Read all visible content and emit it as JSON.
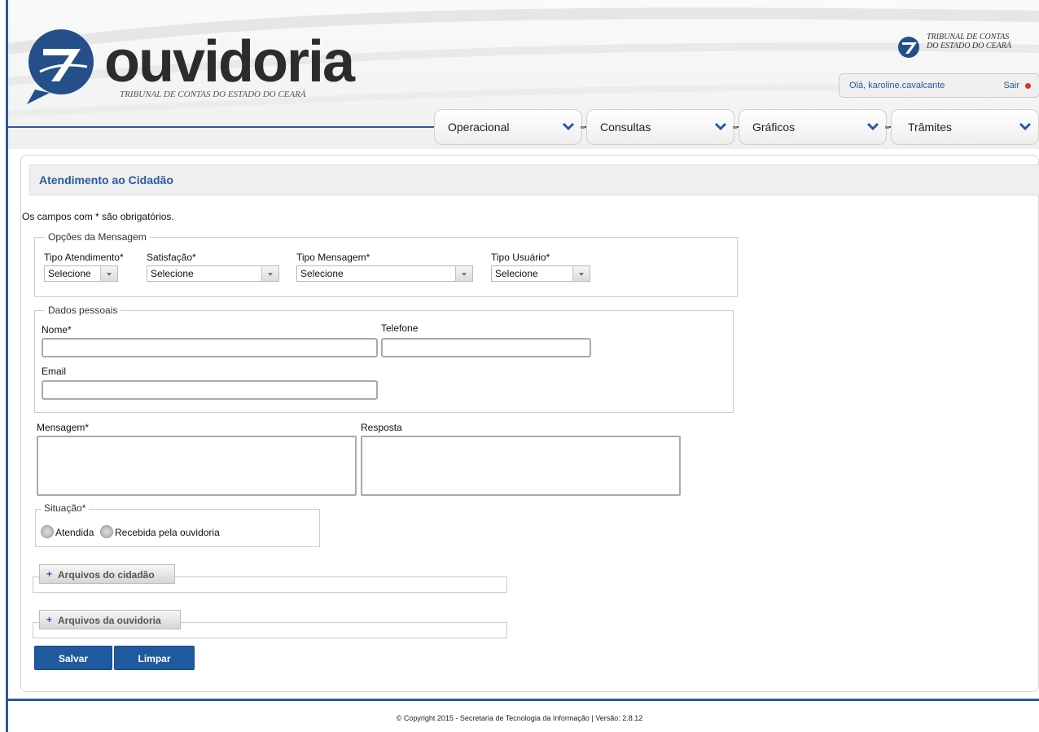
{
  "brand": {
    "name": "ouvidoria",
    "subtitle": "TRIBUNAL DE CONTAS DO ESTADO DO CEARÁ"
  },
  "org_logo": {
    "line1": "TRIBUNAL DE CONTAS",
    "line2": "DO ESTADO DO CEARÁ"
  },
  "user": {
    "greeting": "Olá, karoline.cavalcante",
    "logout": "Sair"
  },
  "menu": [
    {
      "label": "Operacional"
    },
    {
      "label": "Consultas"
    },
    {
      "label": "Gráficos"
    },
    {
      "label": "Trâmites"
    }
  ],
  "page": {
    "title": "Atendimento ao Cidadão",
    "required_note": "Os campos com * são obrigatórios."
  },
  "options": {
    "legend": "Opções da Mensagem",
    "tipo_atendimento": {
      "label": "Tipo Atendimento*",
      "value": "Selecione"
    },
    "satisfacao": {
      "label": "Satisfação*",
      "value": "Selecione"
    },
    "tipo_mensagem": {
      "label": "Tipo Mensagem*",
      "value": "Selecione"
    },
    "tipo_usuario": {
      "label": "Tipo Usuário*",
      "value": "Selecione"
    }
  },
  "personal": {
    "legend": "Dados pessoais",
    "nome": {
      "label": "Nome*",
      "value": ""
    },
    "telefone": {
      "label": "Telefone",
      "value": ""
    },
    "email": {
      "label": "Email",
      "value": ""
    }
  },
  "mensagem": {
    "label": "Mensagem*",
    "value": ""
  },
  "resposta": {
    "label": "Resposta",
    "value": ""
  },
  "situacao": {
    "legend": "Situação*",
    "options": [
      "Atendida",
      "Recebida pela ouvidoria"
    ]
  },
  "attachments": {
    "cidadao": "Arquivos do cidadão",
    "ouvidoria": "Arquivos da ouvidoria"
  },
  "actions": {
    "save": "Salvar",
    "clear": "Limpar"
  },
  "footer": {
    "text": "© Copyright 2015 - Secretaria de Tecnologia da Informação | Versão: 2.8.12"
  },
  "colors": {
    "accent": "#2a5a9a",
    "button": "#1f5a9e",
    "logout_dot": "#dd3322"
  }
}
